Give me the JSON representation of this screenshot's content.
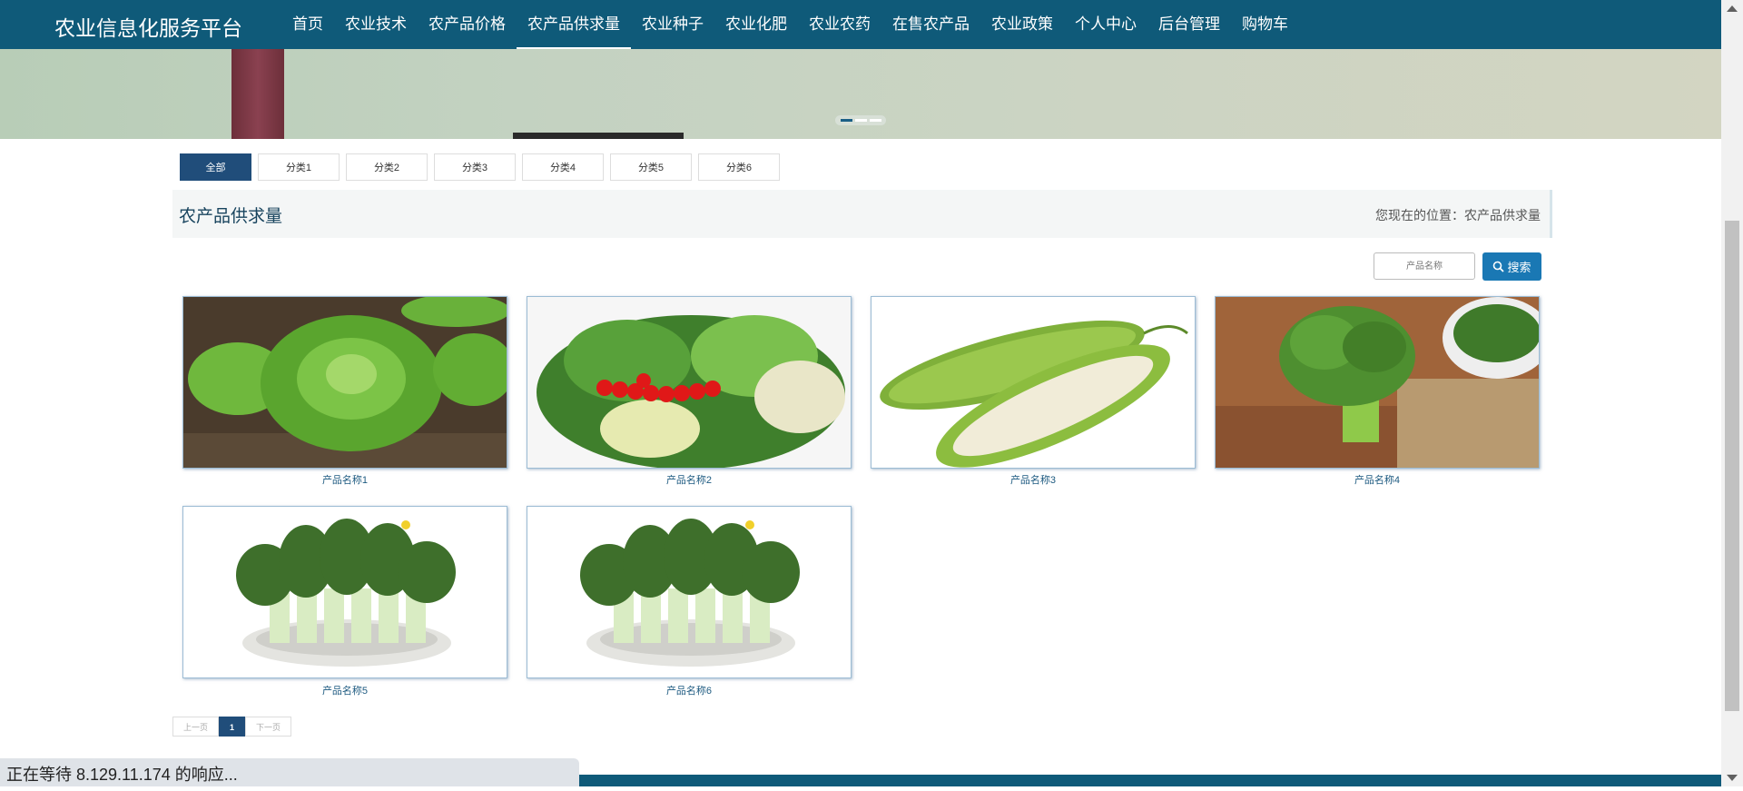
{
  "nav": {
    "brand": "农业信息化服务平台",
    "items": [
      {
        "label": "首页",
        "active": false
      },
      {
        "label": "农业技术",
        "active": false
      },
      {
        "label": "农产品价格",
        "active": false
      },
      {
        "label": "农产品供求量",
        "active": true
      },
      {
        "label": "农业种子",
        "active": false
      },
      {
        "label": "农业化肥",
        "active": false
      },
      {
        "label": "农业农药",
        "active": false
      },
      {
        "label": "在售农产品",
        "active": false
      },
      {
        "label": "农业政策",
        "active": false
      },
      {
        "label": "个人中心",
        "active": false
      },
      {
        "label": "后台管理",
        "active": false
      },
      {
        "label": "购物车",
        "active": false
      }
    ]
  },
  "banner": {
    "slide_count": 3,
    "active_slide": 1
  },
  "categories": [
    "全部",
    "分类1",
    "分类2",
    "分类3",
    "分类4",
    "分类5",
    "分类6"
  ],
  "section": {
    "title": "农产品供求量",
    "breadcrumb": "您现在的位置：农产品供求量"
  },
  "search": {
    "placeholder": "产品名称",
    "button_label": "搜索",
    "icon": "search-icon"
  },
  "products": [
    {
      "name": "产品名称1",
      "image": "lettuce-field"
    },
    {
      "name": "产品名称2",
      "image": "vegetable-platter"
    },
    {
      "name": "产品名称3",
      "image": "bitter-melon"
    },
    {
      "name": "产品名称4",
      "image": "broccoli"
    },
    {
      "name": "产品名称5",
      "image": "bok-choy-plate"
    },
    {
      "name": "产品名称6",
      "image": "bok-choy-plate"
    }
  ],
  "pagination": {
    "prev": "上一页",
    "current": "1",
    "next": "下一页"
  },
  "status_bar": "正在等待 8.129.11.174 的响应...",
  "colors": {
    "nav": "#0f5a79",
    "accent": "#204d7a",
    "search_button": "#1a78b4"
  }
}
